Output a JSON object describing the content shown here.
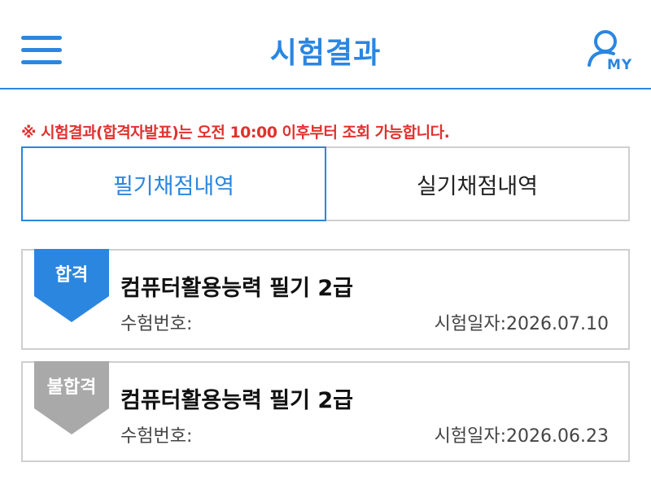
{
  "header": {
    "title": "시험결과",
    "my_label": "MY",
    "menu_icon": "hamburger-menu-icon",
    "profile_icon": "user-profile-icon",
    "accent_color": "#2b86e0"
  },
  "notice": {
    "prefix": "※",
    "text": "시험결과(합격자발표)는 오전 10:00 이후부터 조회 가능합니다.",
    "color": "#e0322e"
  },
  "tabs": [
    {
      "label": "필기채점내역",
      "active": true
    },
    {
      "label": "실기채점내역",
      "active": false
    }
  ],
  "results": [
    {
      "badge": "합격",
      "badge_color": "#2b86e0",
      "subject": "컴퓨터활용능력 필기 2급",
      "exam_no_label": "수험번호:",
      "exam_date_label": "시험일자:",
      "exam_date": "2026.07.10"
    },
    {
      "badge": "불합격",
      "badge_color": "#a9a9a9",
      "subject": "컴퓨터활용능력 필기 2급",
      "exam_no_label": "수험번호:",
      "exam_date_label": "시험일자:",
      "exam_date": "2026.06.23"
    }
  ]
}
